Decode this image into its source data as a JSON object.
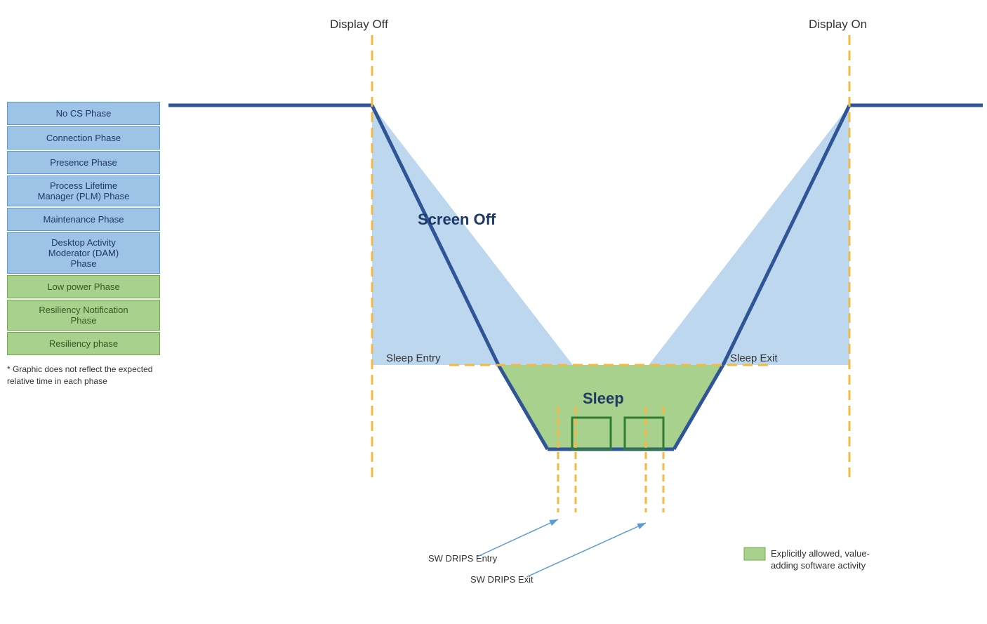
{
  "legend": {
    "items": [
      {
        "label": "No CS Phase",
        "type": "blue"
      },
      {
        "label": "Connection Phase",
        "type": "blue"
      },
      {
        "label": "Presence Phase",
        "type": "blue"
      },
      {
        "label": "Process Lifetime\nManager (PLM) Phase",
        "type": "blue"
      },
      {
        "label": "Maintenance Phase",
        "type": "blue"
      },
      {
        "label": "Desktop Activity\nModerator (DAM)\nPhase",
        "type": "blue"
      },
      {
        "label": "Low power Phase",
        "type": "green"
      },
      {
        "label": "Resiliency Notification\nPhase",
        "type": "green"
      },
      {
        "label": "Resiliency phase",
        "type": "green"
      }
    ],
    "note": "* Graphic does not reflect the expected relative time in each phase"
  },
  "diagram": {
    "display_off_label": "Display Off",
    "display_on_label": "Display On",
    "screen_off_label": "Screen Off",
    "sleep_label": "Sleep",
    "sleep_entry_label": "Sleep Entry",
    "sleep_exit_label": "Sleep Exit",
    "sw_drips_entry_label": "SW DRIPS Entry",
    "sw_drips_exit_label": "SW DRIPS Exit",
    "legend_text": "Explicitly allowed, value-\nadding software activity"
  }
}
